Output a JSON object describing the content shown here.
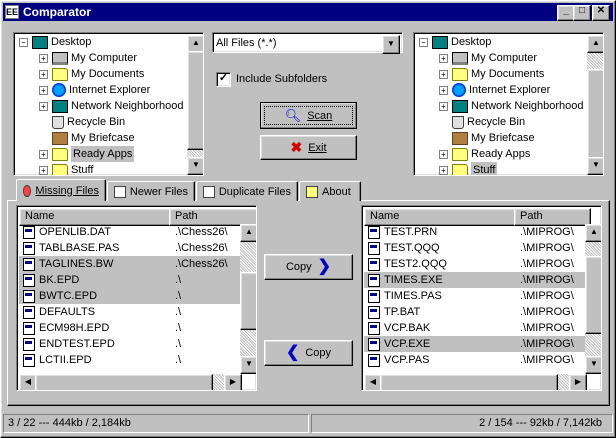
{
  "window": {
    "title": "Comparator",
    "icon": "comparator-app-icon"
  },
  "title_buttons": [
    "minimize",
    "maximize",
    "close"
  ],
  "left_tree": {
    "items": [
      {
        "label": "Desktop",
        "icon": "desktop-icon",
        "expander": "−",
        "level": 0
      },
      {
        "label": "My Computer",
        "icon": "computer-icon",
        "expander": "+",
        "level": 1
      },
      {
        "label": "My Documents",
        "icon": "folder-icon",
        "expander": "+",
        "level": 1
      },
      {
        "label": "Internet Explorer",
        "icon": "internet-explorer-icon",
        "expander": "+",
        "level": 1
      },
      {
        "label": "Network Neighborhood",
        "icon": "network-icon",
        "expander": "+",
        "level": 1
      },
      {
        "label": "Recycle Bin",
        "icon": "recycle-bin-icon",
        "expander": "",
        "level": 1
      },
      {
        "label": "My Briefcase",
        "icon": "briefcase-icon",
        "expander": "",
        "level": 1
      },
      {
        "label": "Ready Apps",
        "icon": "folder-icon",
        "expander": "+",
        "level": 1,
        "selected": true
      },
      {
        "label": "Stuff",
        "icon": "folder-icon",
        "expander": "+",
        "level": 1
      }
    ]
  },
  "right_tree": {
    "items": [
      {
        "label": "Desktop",
        "icon": "desktop-icon",
        "expander": "−",
        "level": 0
      },
      {
        "label": "My Computer",
        "icon": "computer-icon",
        "expander": "+",
        "level": 1
      },
      {
        "label": "My Documents",
        "icon": "folder-icon",
        "expander": "+",
        "level": 1
      },
      {
        "label": "Internet Explorer",
        "icon": "internet-explorer-icon",
        "expander": "+",
        "level": 1
      },
      {
        "label": "Network Neighborhood",
        "icon": "network-icon",
        "expander": "+",
        "level": 1
      },
      {
        "label": "Recycle Bin",
        "icon": "recycle-bin-icon",
        "expander": "",
        "level": 1
      },
      {
        "label": "My Briefcase",
        "icon": "briefcase-icon",
        "expander": "",
        "level": 1
      },
      {
        "label": "Ready Apps",
        "icon": "folder-icon",
        "expander": "+",
        "level": 1
      },
      {
        "label": "Stuff",
        "icon": "folder-icon",
        "expander": "+",
        "level": 1,
        "selected": true
      }
    ]
  },
  "filter": {
    "value": "All Files (*.*)"
  },
  "include_subfolders": {
    "label": "Include Subfolders",
    "checked": true
  },
  "scan_button": {
    "label": "Scan"
  },
  "exit_button": {
    "label": "Exit"
  },
  "tabs": [
    {
      "label": "Missing Files",
      "active": true
    },
    {
      "label": "Newer Files",
      "active": false
    },
    {
      "label": "Duplicate Files",
      "active": false
    },
    {
      "label": "About",
      "active": false
    }
  ],
  "left_list": {
    "columns": [
      "Name",
      "Path"
    ],
    "rows": [
      {
        "name": "OPENLIB.DAT",
        "path": ".\\Chess26\\",
        "selected": false
      },
      {
        "name": "TABLBASE.PAS",
        "path": ".\\Chess26\\",
        "selected": false
      },
      {
        "name": "TAGLINES.BW",
        "path": ".\\Chess26\\",
        "selected": true
      },
      {
        "name": "BK.EPD",
        "path": ".\\",
        "selected": true
      },
      {
        "name": "BWTC.EPD",
        "path": ".\\",
        "selected": true
      },
      {
        "name": "DEFAULTS",
        "path": ".\\",
        "selected": false
      },
      {
        "name": "ECM98H.EPD",
        "path": ".\\",
        "selected": false
      },
      {
        "name": "ENDTEST.EPD",
        "path": ".\\",
        "selected": false
      },
      {
        "name": "LCTII.EPD",
        "path": ".\\",
        "selected": false
      }
    ]
  },
  "right_list": {
    "columns": [
      "Name",
      "Path"
    ],
    "rows": [
      {
        "name": "TEST.PRN",
        "path": ".\\MIPROG\\",
        "selected": false
      },
      {
        "name": "TEST.QQQ",
        "path": ".\\MIPROG\\",
        "selected": false
      },
      {
        "name": "TEST2.QQQ",
        "path": ".\\MIPROG\\",
        "selected": false
      },
      {
        "name": "TIMES.EXE",
        "path": ".\\MIPROG\\",
        "selected": true
      },
      {
        "name": "TIMES.PAS",
        "path": ".\\MIPROG\\",
        "selected": false
      },
      {
        "name": "TP.BAT",
        "path": ".\\MIPROG\\",
        "selected": false
      },
      {
        "name": "VCP.BAK",
        "path": ".\\MIPROG\\",
        "selected": false
      },
      {
        "name": "VCP.EXE",
        "path": ".\\MIPROG\\",
        "selected": true
      },
      {
        "name": "VCP.PAS",
        "path": ".\\MIPROG\\",
        "selected": false
      }
    ]
  },
  "copy_right_button": {
    "label": "Copy"
  },
  "copy_left_button": {
    "label": "Copy"
  },
  "status": {
    "left": "3 / 22 --- 444kb / 2,184kb",
    "right": "2 / 154 --- 92kb / 7,142kb"
  },
  "colors": {
    "titlebar": "#000080",
    "face": "#c0c0c0",
    "selection": "#c0c0c0",
    "arrow": "#0000c0",
    "exit_x": "#d00000"
  }
}
